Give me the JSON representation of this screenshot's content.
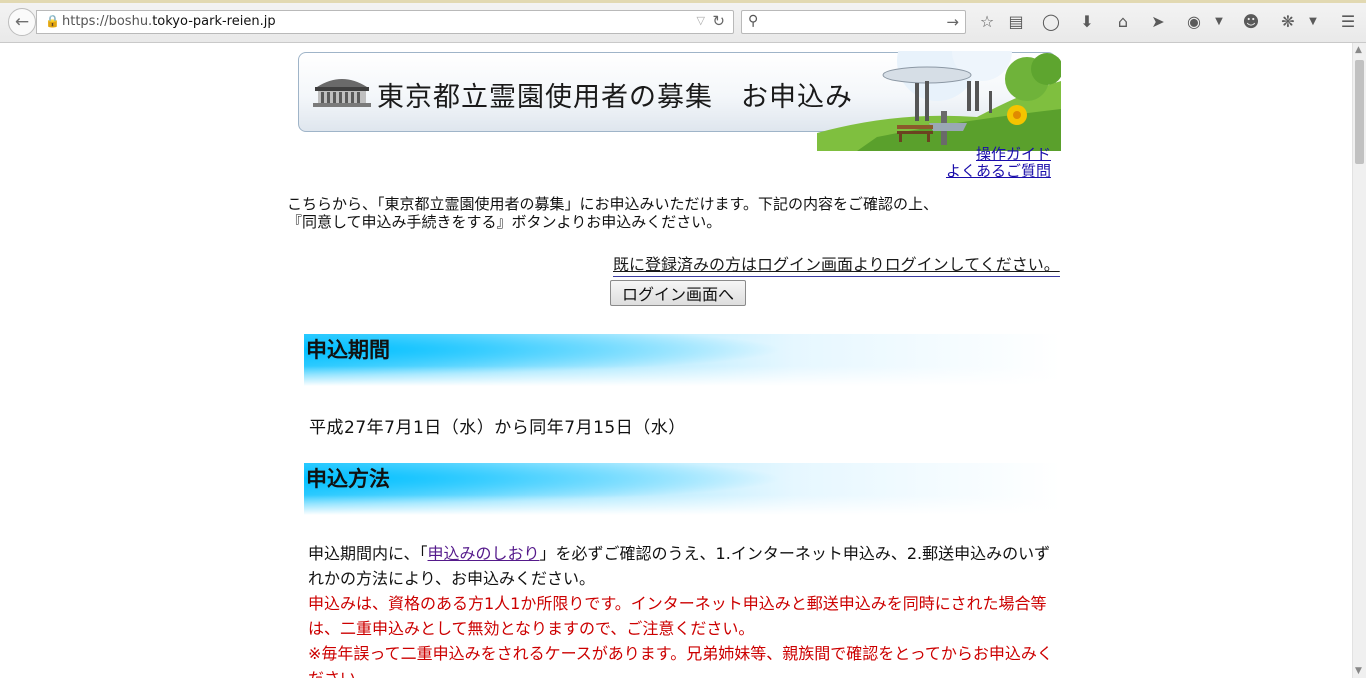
{
  "browser": {
    "url_prefix": "https://boshu.",
    "url_domain": "tokyo-park-reien.jp"
  },
  "banner": {
    "title": "東京都立霊園使用者の募集　お申込み"
  },
  "links": {
    "guide": "操作ガイド",
    "faq": "よくあるご質問"
  },
  "intro": {
    "line1": "こちらから、「東京都立霊園使用者の募集」にお申込みいただけます。下記の内容をご確認の上、",
    "line2": "『同意して申込み手続きをする』ボタンよりお申込みください。"
  },
  "login": {
    "prompt": "既に登録済みの方はログイン画面よりログインしてください。",
    "button": "ログイン画面へ"
  },
  "sections": {
    "period_heading": "申込期間",
    "period_text": "平成27年7月1日（水）から同年7月15日（水）",
    "method_heading": "申込方法",
    "method_pre": "申込期間内に、「",
    "method_link": "申込みのしおり",
    "method_post": "」を必ずご確認のうえ、1.インターネット申込み、2.郵送申込みのいずれかの方法により、お申込みください。",
    "warning1": "申込みは、資格のある方1人1か所限りです。インターネット申込みと郵送申込みを同時にされた場合等は、二重申込みとして無効となりますので、ご注意ください。",
    "warning2": "※毎年誤って二重申込みをされるケースがあります。兄弟姉妹等、親族間で確認をとってからお申込みください。"
  },
  "colors": {
    "section_gradient": "#00bfff",
    "warning": "#cc0000",
    "link": "#1a0dab"
  }
}
